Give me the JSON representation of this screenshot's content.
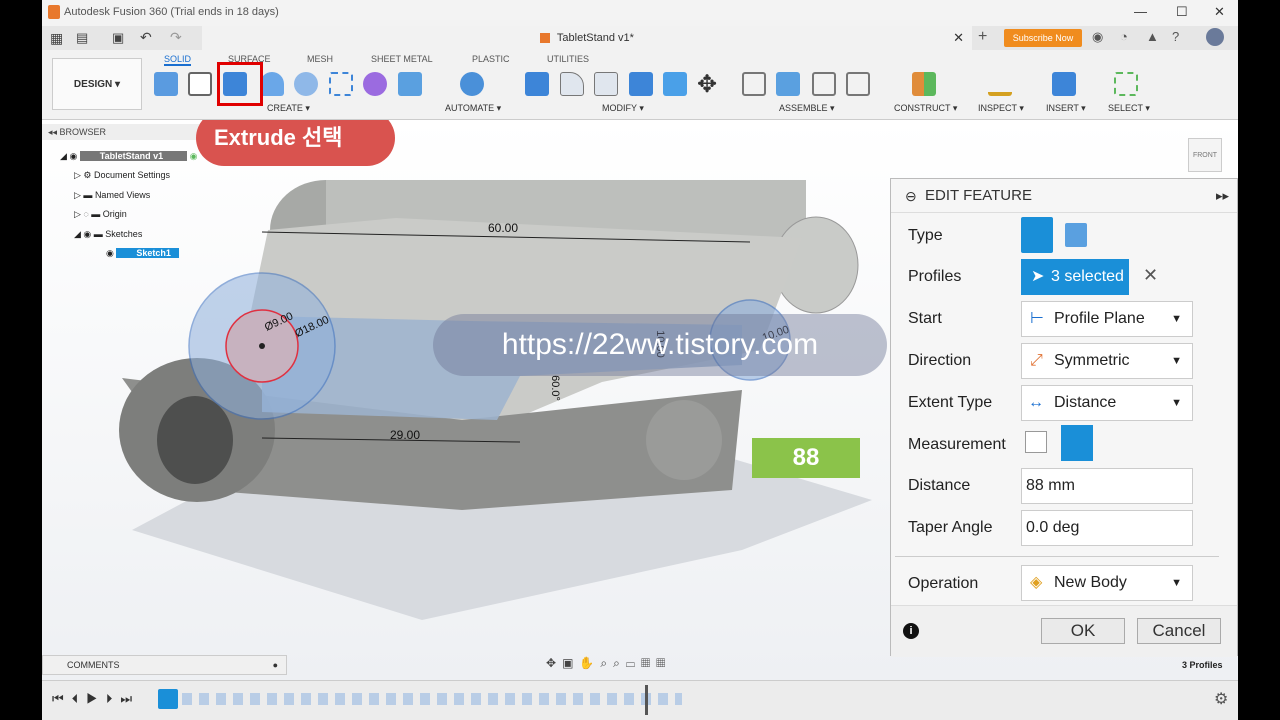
{
  "window": {
    "title": "Autodesk Fusion 360 (Trial ends in 18 days)"
  },
  "doc_tab": {
    "label": "TabletStand v1*",
    "subscribe": "Subscribe Now"
  },
  "ribbon": {
    "workspace": "DESIGN ▾",
    "tabs": [
      "SOLID",
      "SURFACE",
      "MESH",
      "SHEET METAL",
      "PLASTIC",
      "UTILITIES"
    ],
    "groups": [
      "CREATE ▾",
      "AUTOMATE ▾",
      "MODIFY ▾",
      "ASSEMBLE ▾",
      "CONSTRUCT ▾",
      "INSPECT ▾",
      "INSERT ▾",
      "SELECT ▾"
    ]
  },
  "annotation": {
    "label": "Extrude 선택"
  },
  "browser": {
    "header": "BROWSER",
    "items": [
      {
        "label": "TabletStand v1"
      },
      {
        "label": "Document Settings"
      },
      {
        "label": "Named Views"
      },
      {
        "label": "Origin"
      },
      {
        "label": "Sketches"
      },
      {
        "label": "Sketch1"
      }
    ]
  },
  "dimensions": {
    "d1": "60.00",
    "d2": "Ø9.00",
    "d3": "Ø18.00",
    "d4": "29.00",
    "d5": "60.0°",
    "d6": "10.00",
    "d7": "10.00"
  },
  "watermark": "https://22ww.tistory.com",
  "value_overlay": "88",
  "viewcube": {
    "label": "FRONT"
  },
  "edit_feature": {
    "title": "EDIT FEATURE",
    "type_label": "Type",
    "profiles_label": "Profiles",
    "profiles_value": "3 selected",
    "start_label": "Start",
    "start_value": "Profile Plane",
    "direction_label": "Direction",
    "direction_value": "Symmetric",
    "extent_label": "Extent Type",
    "extent_value": "Distance",
    "measurement_label": "Measurement",
    "distance_label": "Distance",
    "distance_value": "88 mm",
    "taper_label": "Taper Angle",
    "taper_value": "0.0 deg",
    "operation_label": "Operation",
    "operation_value": "New Body",
    "ok": "OK",
    "cancel": "Cancel"
  },
  "comments": "COMMENTS",
  "status": "3 Profiles",
  "colors": {
    "accent": "#1a8fd8",
    "annotation": "#d9534f",
    "value_bg": "#8bc34a"
  }
}
